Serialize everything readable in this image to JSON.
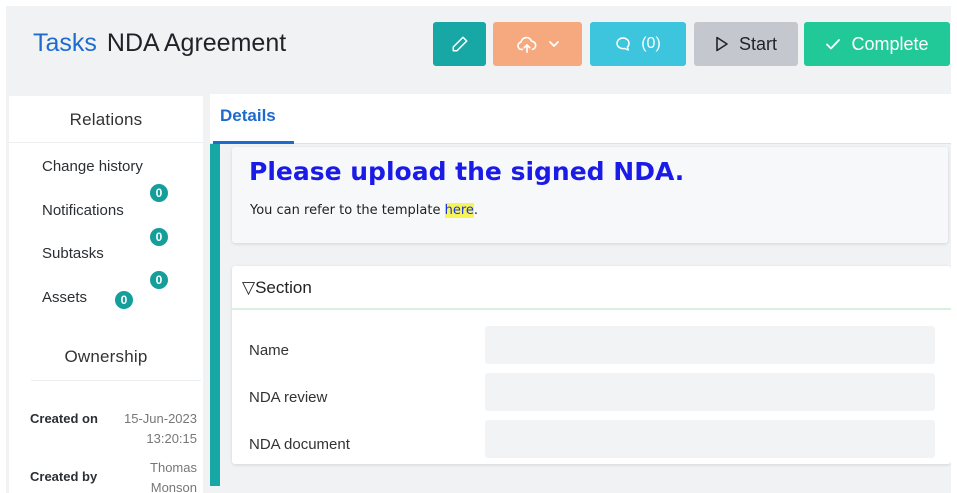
{
  "header": {
    "breadcrumb": "Tasks",
    "title": "NDA Agreement",
    "comment_label": "(0)",
    "start_label": "Start",
    "complete_label": "Complete"
  },
  "sidebar": {
    "relations_title": "Relations",
    "items": [
      {
        "label": "Change history",
        "count": null
      },
      {
        "label": "Notifications",
        "count": "0"
      },
      {
        "label": "Subtasks",
        "count": "0"
      },
      {
        "label": "Assets",
        "count": "0"
      }
    ],
    "extra_badge": "0",
    "ownership_title": "Ownership",
    "ownership": {
      "created_on_label": "Created on",
      "created_on_value": "15-Jun-2023 13:20:15",
      "created_by_label": "Created by",
      "created_by_value": "Thomas Monson"
    }
  },
  "main": {
    "tabs": [
      {
        "label": "Details",
        "active": true
      }
    ],
    "note": {
      "heading": "Please upload the signed NDA.",
      "text_before": "You can refer to the template ",
      "link_text": "here",
      "text_after": "."
    },
    "section": {
      "title": "▽Section",
      "fields": [
        {
          "label": "Name",
          "value": ""
        },
        {
          "label": "NDA review",
          "value": ""
        },
        {
          "label": "NDA document",
          "value": ""
        }
      ]
    }
  },
  "colors": {
    "edit_button": "#17a7a5",
    "upload_button": "#f6a97f",
    "comment_button": "#3cc5dd",
    "start_button": "#c4c8ce",
    "complete_button": "#20c997",
    "badge": "#159e9a",
    "link_blue": "#1e6bd0",
    "note_heading": "#1b1be8",
    "highlight": "#f7f45a"
  },
  "icons": {
    "edit": "pencil-icon",
    "upload": "cloud-upload-icon",
    "upload_caret": "chevron-down-icon",
    "comment": "speech-bubble-icon",
    "start": "play-icon",
    "complete": "check-icon"
  }
}
